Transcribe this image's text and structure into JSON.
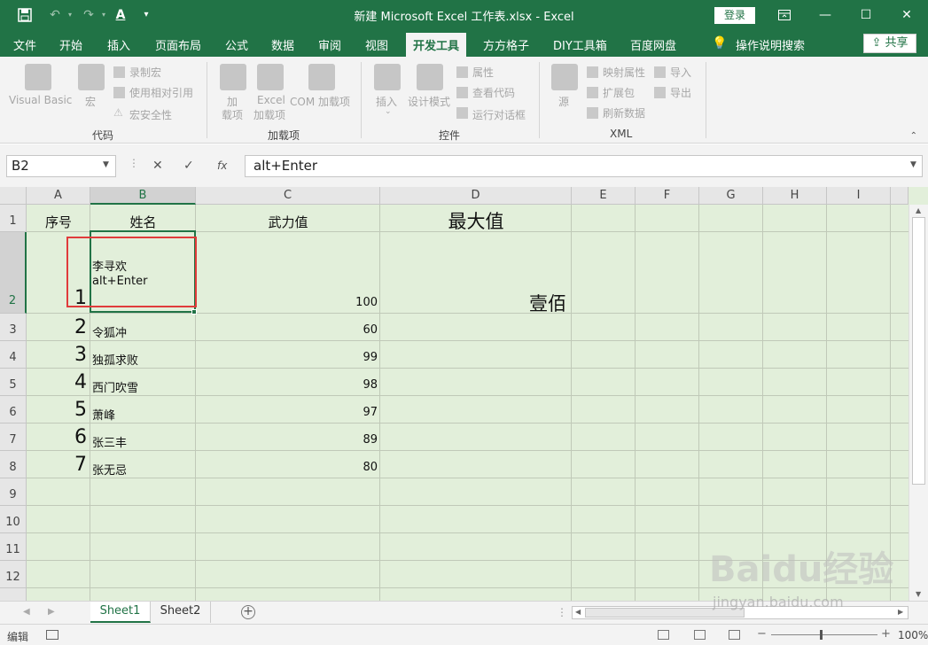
{
  "window": {
    "title": "新建 Microsoft Excel 工作表.xlsx  -  Excel",
    "login_label": "登录",
    "save_icon": "save-icon",
    "undo_icon": "undo-icon",
    "redo_icon": "redo-icon",
    "font_color_glyph": "A"
  },
  "menu": {
    "tabs": [
      "文件",
      "开始",
      "插入",
      "页面布局",
      "公式",
      "数据",
      "审阅",
      "视图",
      "开发工具",
      "方方格子",
      "DIY工具箱",
      "百度网盘"
    ],
    "active_tab": "开发工具",
    "help_search": "操作说明搜索",
    "share_label": "共享"
  },
  "ribbon": {
    "groups": {
      "code": {
        "label": "代码",
        "visual_basic": "Visual Basic",
        "macros": "宏",
        "record_macro": "录制宏",
        "relative_refs": "使用相对引用",
        "macro_security": "宏安全性"
      },
      "addins": {
        "label": "加载项",
        "addins_btn_line1": "加",
        "addins_btn_line2": "载项",
        "excel_addins_line1": "Excel",
        "excel_addins_line2": "加载项",
        "com_addins": "COM 加载项"
      },
      "controls": {
        "label": "控件",
        "insert": "插入",
        "design_mode": "设计模式",
        "properties": "属性",
        "view_code": "查看代码",
        "run_dialog": "运行对话框"
      },
      "xml": {
        "label": "XML",
        "source": "源",
        "map_properties": "映射属性",
        "expansion_packs": "扩展包",
        "refresh_data": "刷新数据",
        "import": "导入",
        "export": "导出"
      }
    }
  },
  "formula_bar": {
    "name_box": "B2",
    "formula": "alt+Enter",
    "fx": "fx"
  },
  "sheet": {
    "columns": [
      "A",
      "B",
      "C",
      "D",
      "E",
      "F",
      "G",
      "H",
      "I"
    ],
    "selected_column": "B",
    "selected_row": "2",
    "rows": [
      "1",
      "2",
      "3",
      "4",
      "5",
      "6",
      "7",
      "8",
      "9",
      "10",
      "11",
      "12"
    ],
    "header": {
      "A1": "序号",
      "B1": "姓名",
      "C1": "武力值",
      "D1": "最大值"
    },
    "data": [
      {
        "seq": "1",
        "name_line1": "李寻欢",
        "name_line2": "alt+Enter",
        "power": "100",
        "max": "壹佰"
      },
      {
        "seq": "2",
        "name": "令狐冲",
        "power": "60"
      },
      {
        "seq": "3",
        "name": "独孤求败",
        "power": "99"
      },
      {
        "seq": "4",
        "name": "西门吹雪",
        "power": "98"
      },
      {
        "seq": "5",
        "name": "萧峰",
        "power": "97"
      },
      {
        "seq": "6",
        "name": "张三丰",
        "power": "89"
      },
      {
        "seq": "7",
        "name": "张无忌",
        "power": "80"
      }
    ]
  },
  "sheet_tabs": [
    "Sheet1",
    "Sheet2"
  ],
  "active_sheet": "Sheet1",
  "status": {
    "mode": "编辑",
    "zoom": "100%"
  },
  "watermark": {
    "main": "Baidu经验",
    "sub": "jingyan.baidu.com"
  }
}
